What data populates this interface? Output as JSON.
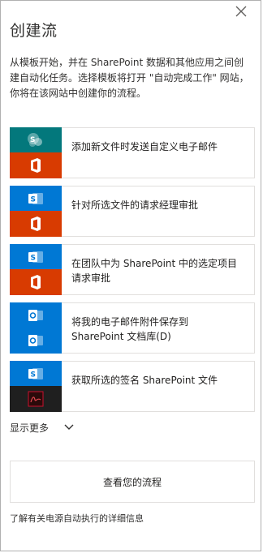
{
  "panel": {
    "title": "创建流",
    "description": "从模板开始，并在 SharePoint 数据和其他应用之间创建自动化任务。选择模板将打开 \"自动完成工作\" 网站，你将在该网站中创建你的流程。"
  },
  "templates": [
    {
      "label": "添加新文件时发送自定义电子邮件",
      "top_icon": "sharepoint-icon",
      "bottom_icon": "office-icon",
      "top_color": "#03787c",
      "bottom_color": "#d83b01"
    },
    {
      "label": "针对所选文件的请求经理审批",
      "top_icon": "sharepoint-icon",
      "bottom_icon": "office-icon",
      "top_color": "#0078d4",
      "bottom_color": "#d83b01"
    },
    {
      "label": "在团队中为 SharePoint 中的选定项目请求审批",
      "top_icon": "sharepoint-icon",
      "bottom_icon": "office-icon",
      "top_color": "#0078d4",
      "bottom_color": "#d83b01"
    },
    {
      "label": "将我的电子邮件附件保存到 SharePoint 文档库(D)",
      "top_icon": "outlook-icon",
      "bottom_icon": "outlook-icon",
      "top_color": "#0078d4",
      "bottom_color": "#0078d4"
    },
    {
      "label": "获取所选的签名 SharePoint 文件",
      "top_icon": "sharepoint-icon",
      "bottom_icon": "adobe-sign-icon",
      "top_color": "#0078d4",
      "bottom_color": "#1f1f1f"
    }
  ],
  "show_more": {
    "label": "显示更多"
  },
  "view_flows": {
    "label": "查看您的流程"
  },
  "learn_more": {
    "label": "了解有关电源自动执行的详细信息"
  }
}
